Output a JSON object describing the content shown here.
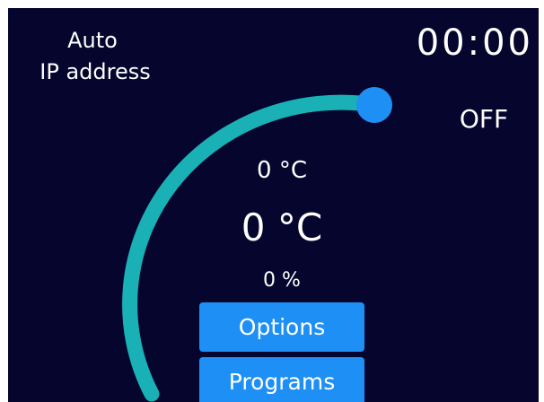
{
  "network": {
    "mode": "Auto",
    "label": "IP address"
  },
  "timer": {
    "value": "00:00"
  },
  "status": {
    "state": "OFF"
  },
  "readings": {
    "temperature_small": "0 °C",
    "temperature_large": "0 °C",
    "percent": "0 %"
  },
  "buttons": {
    "options_label": "Options",
    "programs_label": "Programs"
  },
  "gauge": {
    "value_percent": 0,
    "colors": {
      "track": "#19b1b5",
      "knob": "#1e90f5",
      "background": "#05052e"
    }
  }
}
